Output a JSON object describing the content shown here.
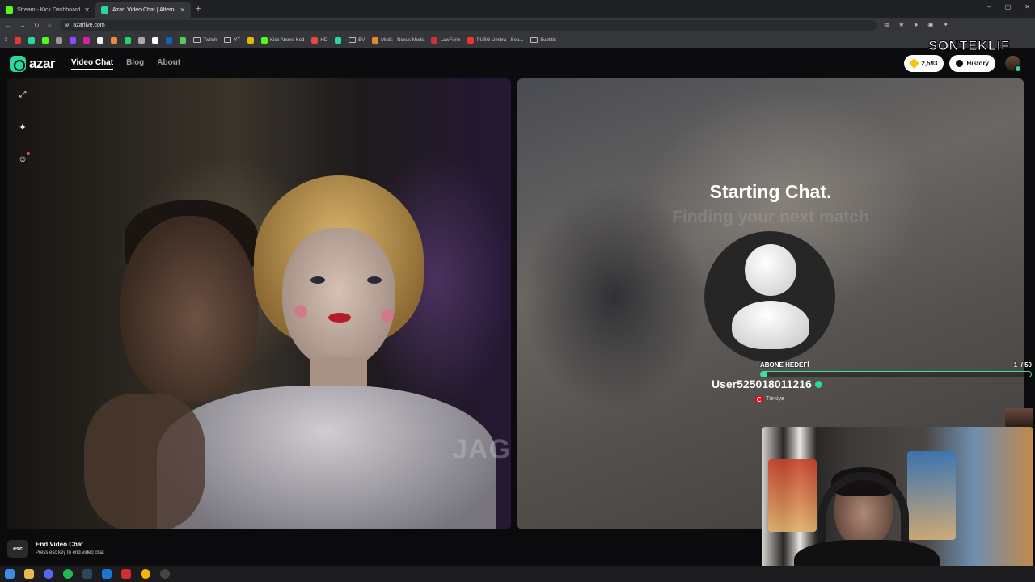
{
  "browser": {
    "tabs": [
      {
        "title": "Stream - Kick Dashboard",
        "favicon_color": "#53fc18",
        "active": false
      },
      {
        "title": "Azar: Video Chat | Alternati",
        "favicon_color": "#2bd9a0",
        "active": true
      }
    ],
    "new_tab": "+",
    "window_controls": [
      "–",
      "▢",
      "✕"
    ],
    "url": "azarlive.com",
    "bookmarks": [
      {
        "label": "Twitch",
        "type": "folder"
      },
      {
        "label": "YT",
        "type": "folder"
      },
      {
        "label": "Kick Abone Kod",
        "type": "site",
        "color": "#53fc18"
      },
      {
        "label": "HD",
        "type": "site",
        "color": "#e44"
      },
      {
        "label": "EV",
        "type": "folder"
      },
      {
        "label": "Mods - Nexus Mods",
        "type": "site",
        "color": "#e8892d"
      },
      {
        "label": "LawForm",
        "type": "site",
        "color": "#c33"
      },
      {
        "label": "PUBG Umbra - Sea...",
        "type": "site",
        "color": "#e33"
      },
      {
        "label": "Subtitle",
        "type": "folder"
      }
    ]
  },
  "overlay": {
    "brand_text": "SONTEKLIF"
  },
  "site": {
    "logo_text": "azar",
    "nav": [
      {
        "label": "Video Chat",
        "active": true
      },
      {
        "label": "Blog",
        "active": false
      },
      {
        "label": "About",
        "active": false
      }
    ],
    "gems": "2,593",
    "history_label": "History"
  },
  "chat": {
    "status_title": "Starting Chat.",
    "status_sub": "Finding your next match",
    "username": "User525018011216",
    "country": "Türkiye"
  },
  "goal": {
    "label": "ABONE HEDEFİ",
    "current": "1",
    "target": "/ 50",
    "progress": 0.02,
    "color": "#36e0a6"
  },
  "watermark": "JAGERMAN",
  "end_chat": {
    "key": "esc",
    "title": "End Video Chat",
    "subtitle": "Press esc key to end video chat"
  },
  "colors": {
    "accent": "#2bd9a0",
    "background": "#0b0b0d"
  }
}
